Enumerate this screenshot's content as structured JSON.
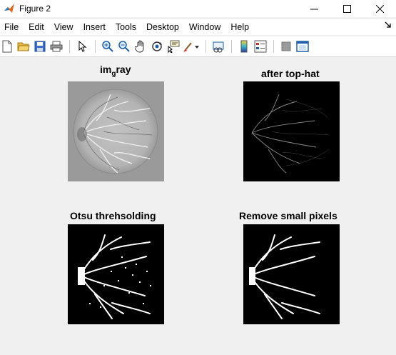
{
  "window": {
    "title": "Figure 2"
  },
  "window_buttons": {
    "minimize": "—",
    "maximize": "☐",
    "close": "✕"
  },
  "menu": [
    "File",
    "Edit",
    "View",
    "Insert",
    "Tools",
    "Desktop",
    "Window",
    "Help"
  ],
  "plots": [
    {
      "title_main": "im",
      "title_sub": "g",
      "title_rest": "ray"
    },
    {
      "title": "after top-hat"
    },
    {
      "title": "Otsu threhsolding"
    },
    {
      "title": "Remove small pixels"
    }
  ],
  "colors": {
    "background": "#f0f0f0",
    "accent": "#0a64c8"
  }
}
